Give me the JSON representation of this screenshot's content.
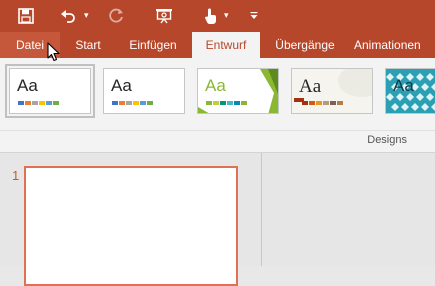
{
  "quick_access": {
    "save": "save-icon",
    "undo": "undo-icon",
    "redo": "redo-icon",
    "present": "present-icon",
    "touch": "touch-mode-icon",
    "customize": "customize-icon"
  },
  "tabs": [
    {
      "label": "Datei"
    },
    {
      "label": "Start"
    },
    {
      "label": "Einfügen"
    },
    {
      "label": "Entwurf"
    },
    {
      "label": "Übergänge"
    },
    {
      "label": "Animationen"
    }
  ],
  "active_tab": "Entwurf",
  "designs": {
    "group_label": "Designs",
    "themes": [
      {
        "aa": "Aa",
        "swatches": [
          "#4472c4",
          "#ed7d31",
          "#a5a5a5",
          "#ffc000",
          "#5b9bd5",
          "#70ad47"
        ]
      },
      {
        "aa": "Aa",
        "swatches": [
          "#4472c4",
          "#ed7d31",
          "#a5a5a5",
          "#ffc000",
          "#5b9bd5",
          "#70ad47"
        ]
      },
      {
        "aa": "Aa",
        "swatches": [
          "#8ab833",
          "#c0cf3a",
          "#029676",
          "#4ab5c4",
          "#0989b1",
          "#8ab833"
        ]
      },
      {
        "aa": "Aa",
        "swatches": [
          "#a5300f",
          "#d55816",
          "#e19825",
          "#b19c7d",
          "#7f5f52",
          "#b27d49"
        ]
      },
      {
        "aa": "Aa",
        "swatches": [
          "#1cade4",
          "#2683c6",
          "#27ced7",
          "#42ba97",
          "#3e8853",
          "#62a39f"
        ]
      }
    ]
  },
  "slides": [
    {
      "number": "1"
    }
  ],
  "colors": {
    "accent": "#b7472a",
    "slide_border": "#e07155"
  }
}
